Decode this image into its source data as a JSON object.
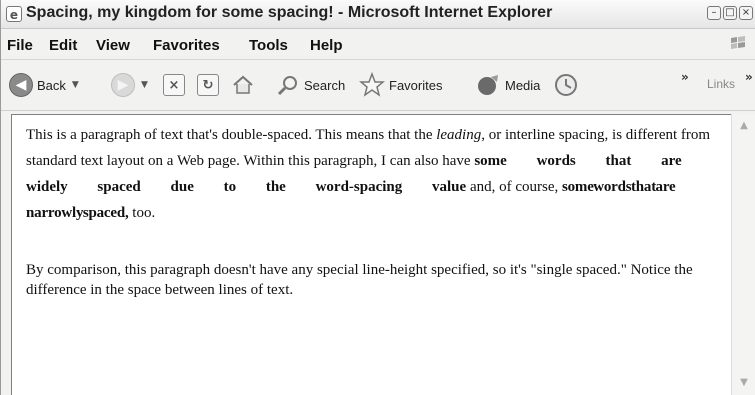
{
  "window": {
    "title": "Spacing, my kingdom for some spacing! - Microsoft Internet Explorer",
    "controls": [
      "minimize",
      "maximize",
      "close"
    ]
  },
  "menu": {
    "items": [
      "File",
      "Edit",
      "View",
      "Favorites",
      "Tools",
      "Help"
    ]
  },
  "toolbar": {
    "back_label": "Back",
    "search_label": "Search",
    "favorites_label": "Favorites",
    "media_label": "Media",
    "links_label": "Links",
    "chevron": "»"
  },
  "content": {
    "p1": {
      "part1": "This is a paragraph of text that's double-spaced. This means that the ",
      "leading": "leading",
      "part2": ", or interline spacing, is different from standard text layout on a Web page. Within this paragraph, I can also have ",
      "wide_words": "some words that are widely spaced due to the word-spacing value",
      "part3": " and, of course, ",
      "narrow_words": "some words that are narrowly spaced,",
      "part4": " too."
    },
    "p2": "By comparison, this paragraph doesn't have any special line-height specified, so it's \"single spaced.\" Notice the difference in the space between lines of text."
  },
  "colors": {
    "chrome": "#f2f2f0",
    "content_bg": "#ffffff",
    "text": "#111111"
  }
}
